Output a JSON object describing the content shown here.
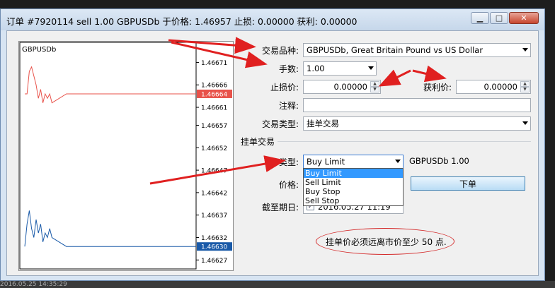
{
  "window": {
    "title": "订单 #7920114 sell 1.00 GBPUSDb 于价格: 1.46957 止损: 0.00000 获利: 0.00000",
    "bottom_strip": "2016.05.25 14:35:29"
  },
  "chart": {
    "symbol": "GBPUSDb",
    "ticks": [
      "1.46671",
      "1.46666",
      "1.46661",
      "1.46657",
      "1.46652",
      "1.46647",
      "1.46642",
      "1.46637",
      "1.46632",
      "1.46627"
    ],
    "ask_label": "1.46664",
    "bid_label": "1.46630",
    "colors": {
      "ask": "#e8524a",
      "bid": "#1a5aa8"
    }
  },
  "chart_data": {
    "type": "line",
    "title": "GBPUSDb",
    "ylim": [
      1.46625,
      1.46675
    ],
    "series": [
      {
        "values": [
          1.46664,
          1.46664,
          1.46669,
          1.4667,
          1.46668,
          1.46666,
          1.46663,
          1.46665,
          1.46662,
          1.46664,
          1.46663,
          1.46664,
          1.46662,
          1.46664,
          1.46664,
          1.46664,
          1.46664,
          1.46664,
          1.46664,
          1.46664,
          1.46664,
          1.46664,
          1.46664
        ]
      },
      {
        "values": [
          1.4663,
          1.46635,
          1.46638,
          1.46634,
          1.46632,
          1.46636,
          1.46633,
          1.46635,
          1.46631,
          1.46633,
          1.46632,
          1.46634,
          1.46632,
          1.4663,
          1.4663,
          1.4663,
          1.4663,
          1.4663,
          1.4663,
          1.4663,
          1.4663,
          1.4663,
          1.4663
        ]
      }
    ]
  },
  "form": {
    "symbol_label": "交易品种:",
    "symbol_value": "GBPUSDb, Great Britain Pound vs US Dollar",
    "volume_label": "手数:",
    "volume_value": "1.00",
    "sl_label": "止损价:",
    "sl_value": "0.00000",
    "tp_label": "获利价:",
    "tp_value": "0.00000",
    "comment_label": "注释:",
    "comment_value": "",
    "exec_label": "交易类型:",
    "exec_value": "挂单交易"
  },
  "pending": {
    "group_label": "挂单交易",
    "type_label": "类型:",
    "type_value": "Buy Limit",
    "type_summary": "GBPUSDb 1.00",
    "type_options": [
      "Buy Limit",
      "Sell Limit",
      "Buy Stop",
      "Sell Stop"
    ],
    "price_label": "价格:",
    "place_button": "下单",
    "expiry_label": "截至期日:",
    "expiry_value": "2016.05.27 11:19",
    "note": "挂单价必须远离市价至少 50 点."
  }
}
